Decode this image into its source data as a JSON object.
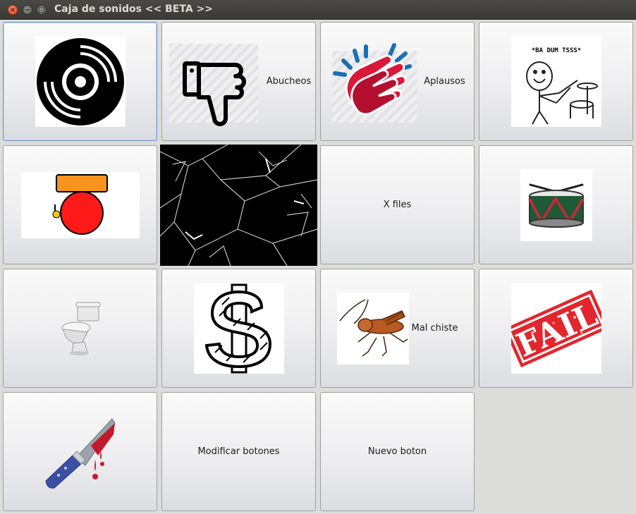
{
  "window": {
    "title": "Caja de sonidos << BETA >>",
    "controls": {
      "close": "×",
      "minimize": "−",
      "maximize": "□"
    }
  },
  "buttons": {
    "vinyl": {
      "icon": "vinyl-record-icon"
    },
    "boo": {
      "label": "Abucheos",
      "icon": "thumbs-down-icon"
    },
    "applause": {
      "label": "Aplausos",
      "icon": "clapping-hands-icon"
    },
    "rimshot": {
      "caption": "*BA DUM TSSS*",
      "icon": "drummer-meme-icon"
    },
    "alarm": {
      "icon": "alarm-bell-icon"
    },
    "glass": {
      "icon": "broken-glass-image"
    },
    "xfiles": {
      "label": "X files"
    },
    "drumroll": {
      "icon": "snare-drum-icon"
    },
    "toilet": {
      "icon": "toilet-icon"
    },
    "money": {
      "icon": "dollar-sign-icon"
    },
    "bad_joke": {
      "label": "Mal chiste",
      "icon": "cricket-icon"
    },
    "fail": {
      "stamp_text": "FAIL",
      "icon": "fail-stamp-icon"
    },
    "knife": {
      "icon": "bloody-knife-icon"
    },
    "modify": {
      "label": "Modificar botones"
    },
    "new": {
      "label": "Nuevo boton"
    }
  }
}
